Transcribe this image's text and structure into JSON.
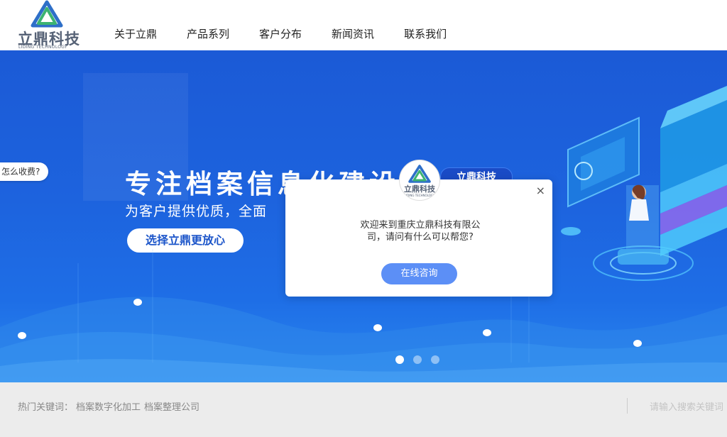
{
  "header": {
    "logo_text": "立鼎科技",
    "logo_sub": "LIDING TECHNOLOGY",
    "nav": [
      "关于立鼎",
      "产品系列",
      "客户分布",
      "新闻资讯",
      "联系我们"
    ]
  },
  "banner": {
    "title": "专注档案信息化建设",
    "subtitle": "为客户提供优质，全面",
    "cta": "选择立鼎更放心",
    "tag": "立鼎科技",
    "float_question": "怎么收费?",
    "slide_count": 3,
    "active_slide": 1
  },
  "hotbar": {
    "label": "热门关键词：",
    "keywords": [
      "档案数字化加工",
      "档案整理公司"
    ],
    "search_placeholder": "请输入搜索关键词"
  },
  "chat": {
    "avatar_text": "立鼎科技",
    "avatar_sub": "LIDING TECHNOLOGY",
    "message": "欢迎来到重庆立鼎科技有限公司，请问有什么可以帮您?",
    "button": "在线咨询",
    "close": "×"
  },
  "colors": {
    "banner_top": "#1b5ad6",
    "banner_bottom": "#2a86ef",
    "chat_button": "#5c8ff6",
    "logo_green": "#3cb371",
    "logo_blue": "#2e6fc8"
  }
}
